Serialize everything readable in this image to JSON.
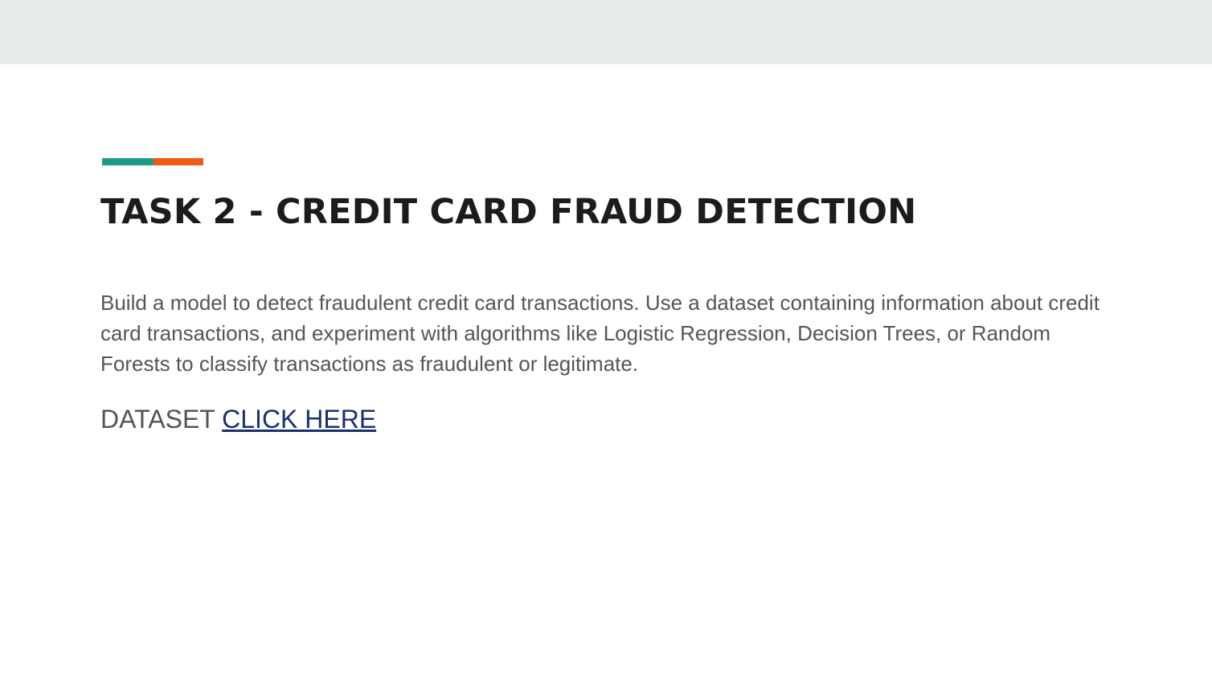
{
  "slide": {
    "title": "TASK 2 - CREDIT CARD FRAUD DETECTION",
    "description": "Build a model to detect fraudulent credit card transactions. Use a dataset containing information about credit card transactions, and experiment with algorithms like Logistic Regression, Decision Trees, or Random Forests to classify transactions as fraudulent or legitimate.",
    "dataset_label": "DATASET",
    "dataset_link_text": "CLICK HERE"
  },
  "colors": {
    "top_band": "#e8ebec",
    "accent_teal": "#1f9a8a",
    "accent_orange": "#ee5a13",
    "title": "#1c1c1c",
    "body_text": "#555555",
    "link": "#1a2f6e"
  }
}
